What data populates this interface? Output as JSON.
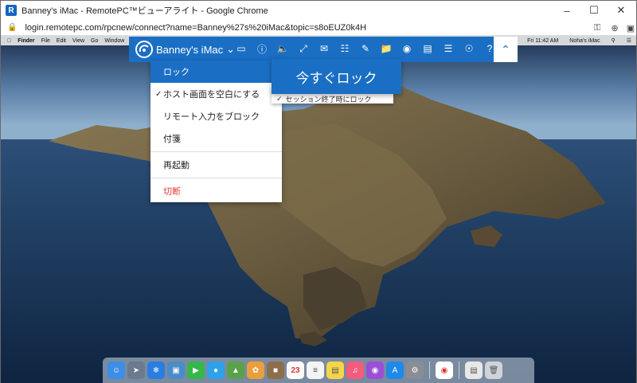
{
  "window": {
    "title": "Banney's iMac - RemotePC™ビューアライト - Google Chrome",
    "url": "login.remotepc.com/rpcnew/connect?name=Banney%27s%20iMac&topic=s8oEUZ0k4H"
  },
  "mac_menubar": {
    "items": [
      "Finder",
      "File",
      "Edit",
      "View",
      "Go",
      "Window"
    ],
    "clock": "Fri 11:42 AM",
    "user": "Noha's iMac"
  },
  "toolbar": {
    "machine_name": "Banney's iMac",
    "icons": [
      "monitor-disconnect-icon",
      "info-icon",
      "volume-icon",
      "resize-icon",
      "chat-icon",
      "message-icon",
      "draw-icon",
      "monitor-icon",
      "file-transfer-icon",
      "camera-icon",
      "notes-icon",
      "menu-icon",
      "view-icon",
      "help-icon"
    ]
  },
  "dropdown": {
    "items": [
      {
        "label": "ロック",
        "active": true,
        "submenu": true
      },
      {
        "label": "ホスト画面を空白にする",
        "checked": true
      },
      {
        "label": "リモート入力をブロック"
      },
      {
        "label": "付箋"
      },
      {
        "label": "再起動"
      },
      {
        "label": "切断",
        "danger": true
      }
    ]
  },
  "submenu": {
    "lock_now": "今すぐロック",
    "lock_on_end": "セッション終了時にロック"
  },
  "colors": {
    "accent": "#1a6fc4",
    "danger": "#e53935"
  }
}
